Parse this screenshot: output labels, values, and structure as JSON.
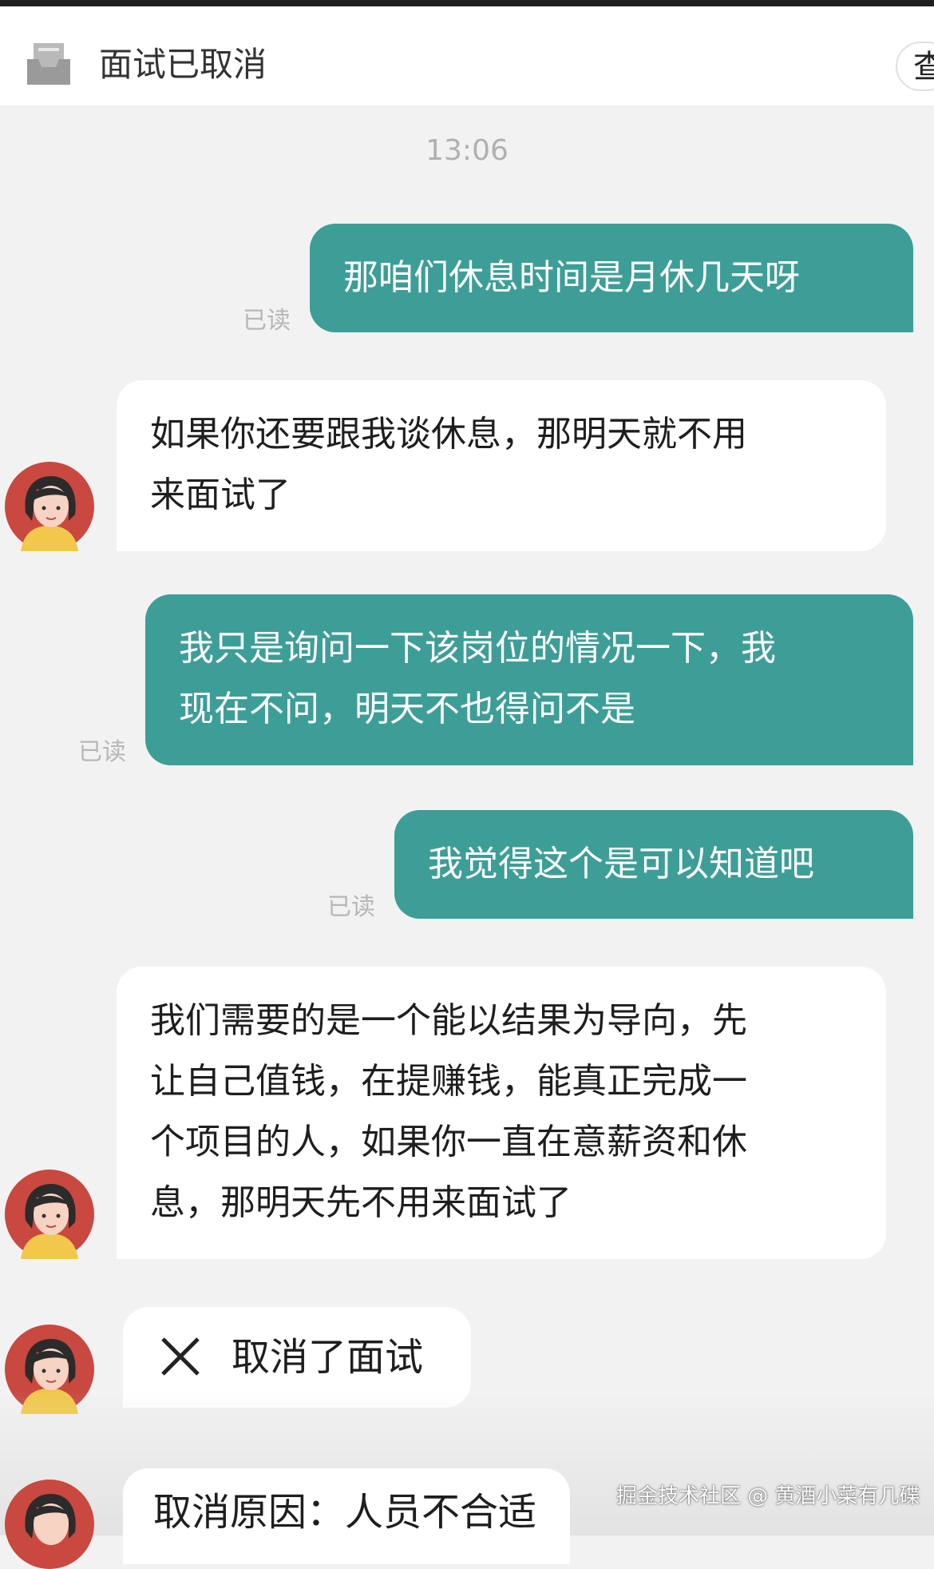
{
  "header": {
    "title": "面试已取消",
    "more_label": "查"
  },
  "chat": {
    "time": "13:06",
    "read_label": "已读",
    "messages": [
      {
        "from": "me",
        "lines": [
          "那咱们休息时间是月休几天呀"
        ]
      },
      {
        "from": "other",
        "lines": [
          "如果你还要跟我谈休息，那明天就不用",
          "来面试了"
        ]
      },
      {
        "from": "me",
        "lines": [
          "我只是询问一下该岗位的情况一下，我",
          "现在不问，明天不也得问不是"
        ]
      },
      {
        "from": "me",
        "lines": [
          "我觉得这个是可以知道吧"
        ]
      },
      {
        "from": "other",
        "lines": [
          "我们需要的是一个能以结果为导向，先",
          "让自己值钱，在提赚钱，能真正完成一",
          "个项目的人，如果你一直在意薪资和休",
          "息，那明天先不用来面试了"
        ]
      }
    ],
    "cancel_notice": "取消了面试",
    "cancel_reason": "取消原因：人员不合适"
  },
  "watermark": "掘金技术社区 @ 黄酒小菜有几碟",
  "colors": {
    "my_bubble": "#3d9e97",
    "other_bubble": "#ffffff",
    "background": "#f2f2f2",
    "avatar_bg": "#c9483f"
  }
}
